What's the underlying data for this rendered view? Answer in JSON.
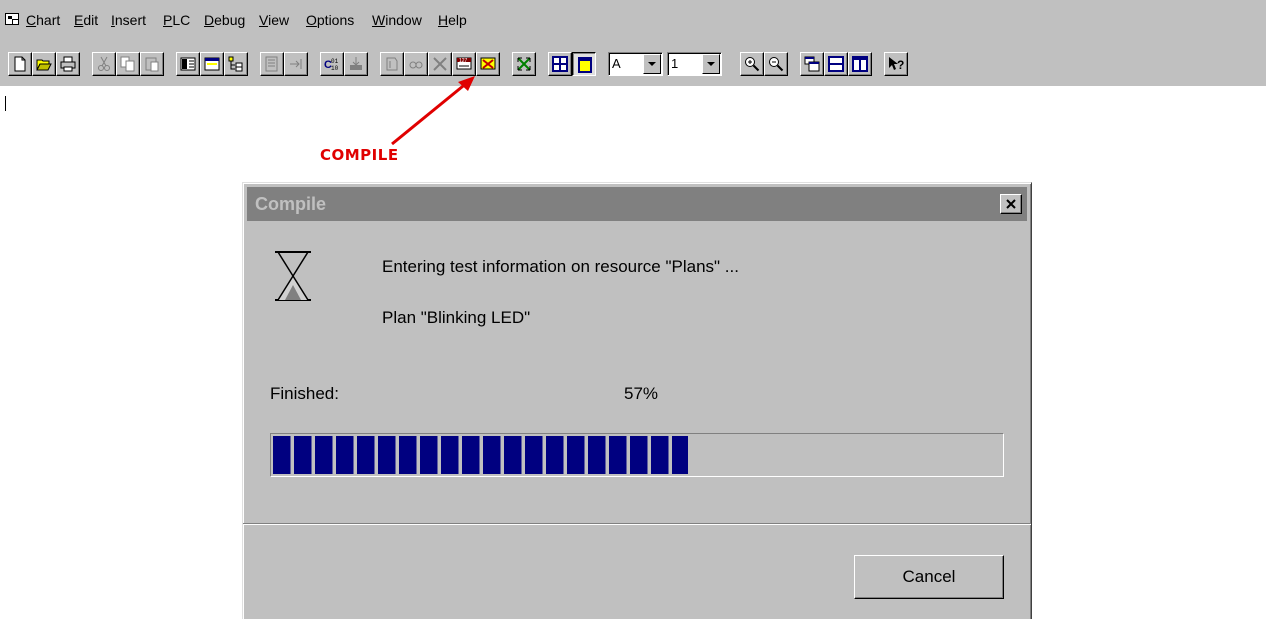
{
  "menubar": {
    "app_icon": "chart-window-icon",
    "items": [
      "Chart",
      "Edit",
      "Insert",
      "PLC",
      "Debug",
      "View",
      "Options",
      "Window",
      "Help"
    ]
  },
  "toolbar": {
    "buttons": [
      {
        "icon": "new-file-icon",
        "enabled": true
      },
      {
        "icon": "open-folder-icon",
        "enabled": true
      },
      {
        "icon": "print-icon",
        "enabled": true
      },
      {
        "icon": "cut-icon",
        "enabled": false
      },
      {
        "icon": "copy-icon",
        "enabled": false
      },
      {
        "icon": "paste-icon",
        "enabled": false
      },
      {
        "icon": "layout-icon",
        "enabled": true
      },
      {
        "icon": "window-icon",
        "enabled": true
      },
      {
        "icon": "tree-icon",
        "enabled": true
      },
      {
        "icon": "list-icon",
        "enabled": false
      },
      {
        "icon": "step-icon",
        "enabled": false
      },
      {
        "icon": "compile-icon",
        "enabled": true
      },
      {
        "icon": "download-icon",
        "enabled": false
      },
      {
        "icon": "plc-icon",
        "enabled": false
      },
      {
        "icon": "watch-icon",
        "enabled": false
      },
      {
        "icon": "breakpoint-icon",
        "enabled": false
      },
      {
        "icon": "force-value-icon",
        "enabled": true
      },
      {
        "icon": "unforce-icon",
        "enabled": true
      },
      {
        "icon": "zoom-fit-icon",
        "enabled": true
      },
      {
        "icon": "table-icon",
        "enabled": true
      },
      {
        "icon": "page-icon",
        "enabled": true,
        "pressed": true
      }
    ],
    "font_combo_value": "A",
    "size_combo_value": "1",
    "buttons2": [
      {
        "icon": "zoom-in-icon"
      },
      {
        "icon": "zoom-out-icon"
      },
      {
        "icon": "cascade-windows-icon"
      },
      {
        "icon": "tile-horizontal-icon"
      },
      {
        "icon": "tile-vertical-icon"
      },
      {
        "icon": "context-help-icon"
      }
    ]
  },
  "annotation": {
    "label": "COMPILE",
    "color": "#e00000"
  },
  "dialog": {
    "title": "Compile",
    "icon": "hourglass-icon",
    "status_line1": "Entering test information on resource \"Plans\" ...",
    "status_line2": "Plan \"Blinking LED\"",
    "finished_label": "Finished:",
    "finished_percent": "57%",
    "progress_fraction": 0.57,
    "cancel_label": "Cancel",
    "title_bar_color": "#808080",
    "progress_color": "#000080"
  }
}
